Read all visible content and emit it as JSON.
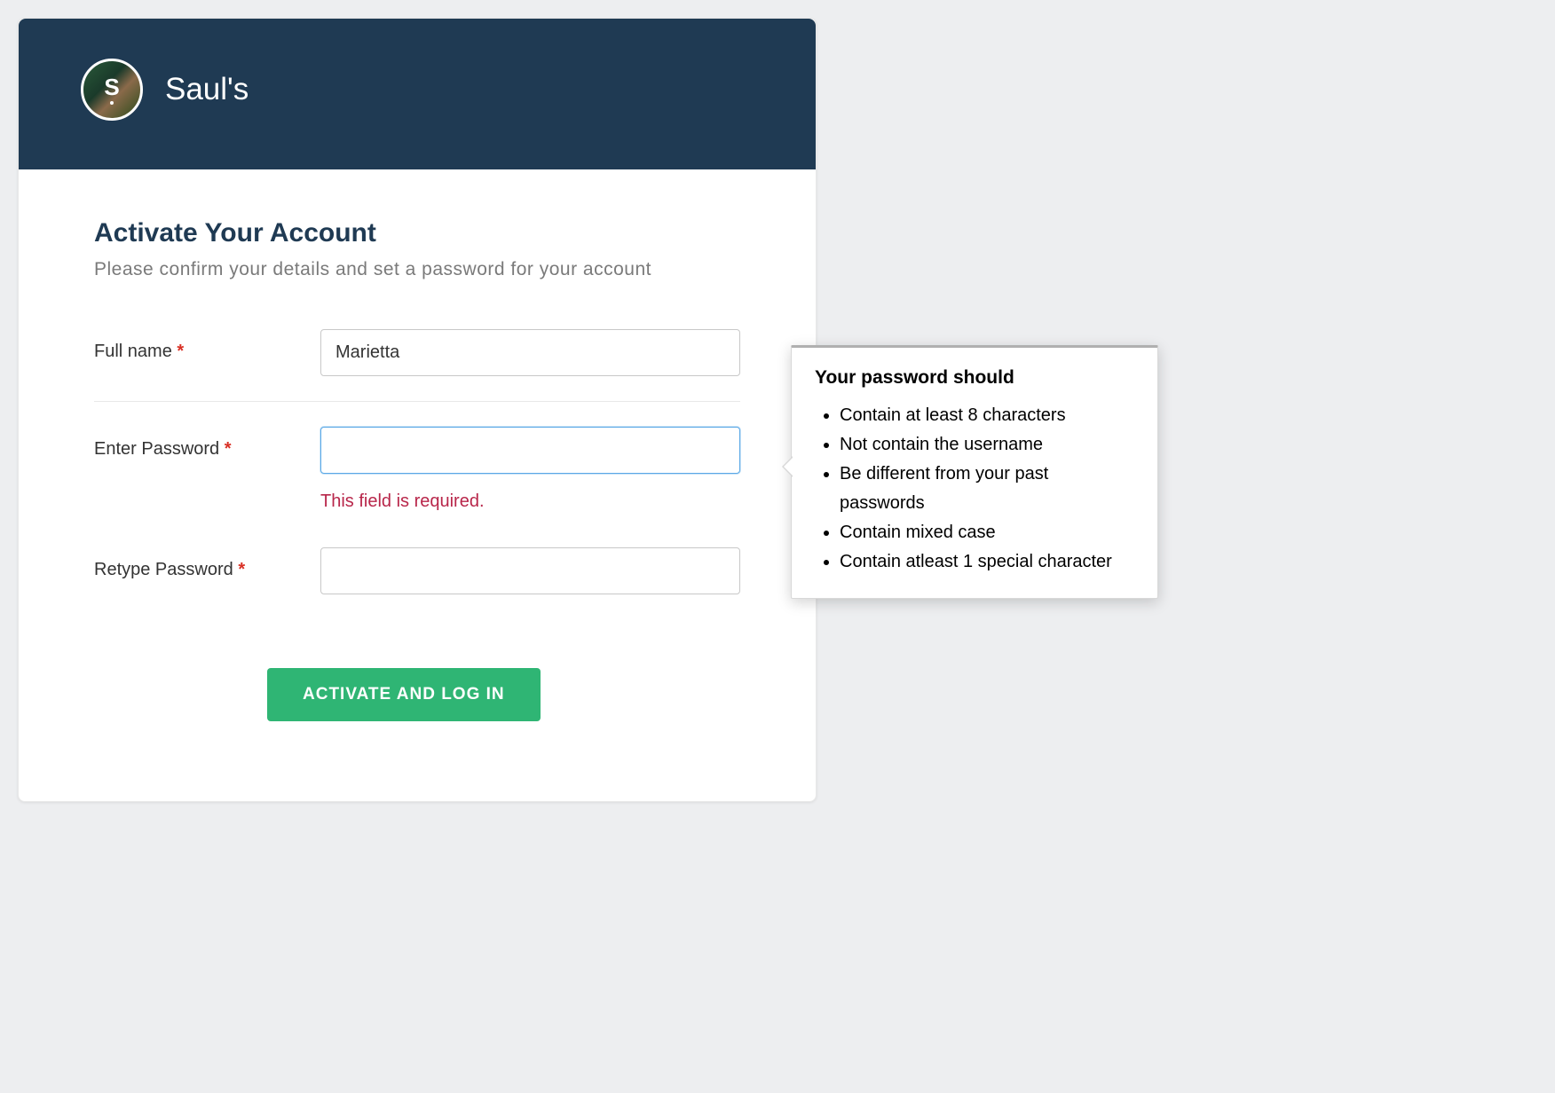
{
  "header": {
    "logo_letter": "S",
    "title": "Saul's"
  },
  "page": {
    "title": "Activate Your Account",
    "subtitle": "Please confirm your details and set a password for your account"
  },
  "form": {
    "full_name": {
      "label": "Full name",
      "required": "*",
      "value": "Marietta"
    },
    "enter_password": {
      "label": "Enter Password",
      "required": "*",
      "value": "",
      "error": "This field is required."
    },
    "retype_password": {
      "label": "Retype Password",
      "required": "*",
      "value": ""
    },
    "submit_label": "ACTIVATE AND LOG IN"
  },
  "tooltip": {
    "title": "Your password should",
    "items": [
      "Contain at least 8 characters",
      "Not contain the username",
      "Be different from your past passwords",
      "Contain mixed case",
      "Contain atleast 1 special character"
    ]
  }
}
